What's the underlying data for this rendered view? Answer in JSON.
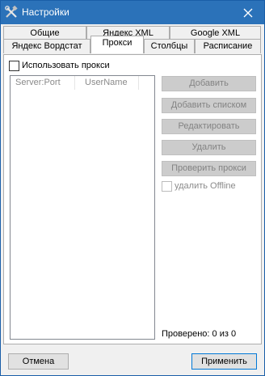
{
  "window": {
    "title": "Настройки"
  },
  "tabs": {
    "row1": [
      {
        "label": "Общие"
      },
      {
        "label": "Яндекс XML"
      },
      {
        "label": "Google XML"
      }
    ],
    "row2": [
      {
        "label": "Яндекс Вордстат"
      },
      {
        "label": "Прокси",
        "active": true
      },
      {
        "label": "Столбцы"
      },
      {
        "label": "Расписание"
      }
    ]
  },
  "proxy": {
    "use_proxy_label": "Использовать прокси",
    "use_proxy_checked": false,
    "columns": [
      "Server:Port",
      "UserName"
    ],
    "buttons": {
      "add": "Добавить",
      "add_list": "Добавить списком",
      "edit": "Редактировать",
      "delete": "Удалить",
      "check": "Проверить прокси"
    },
    "delete_offline_label": "удалить Offline",
    "checked_status": "Проверено: 0 из 0"
  },
  "footer": {
    "cancel": "Отмена",
    "apply": "Применить"
  },
  "colors": {
    "titlebar": "#2b72b9",
    "focus_border": "#0078d7"
  }
}
